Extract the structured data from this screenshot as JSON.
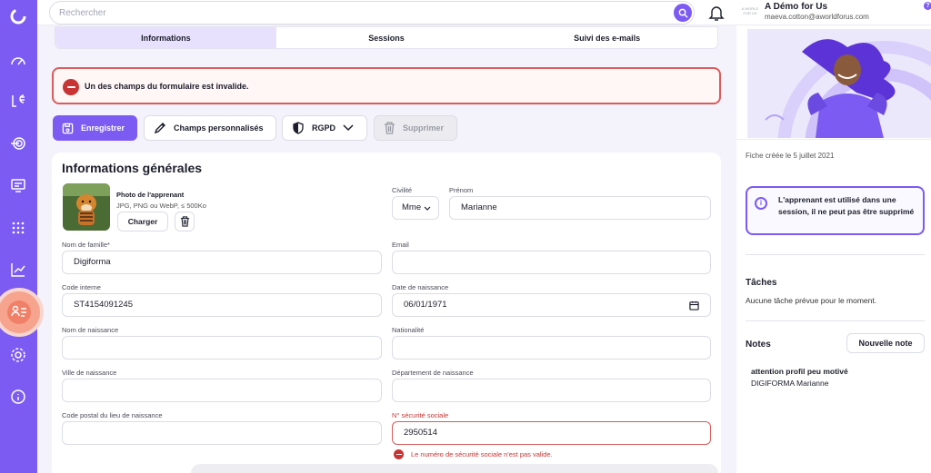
{
  "topbar": {
    "search_placeholder": "Rechercher",
    "brand_name": "A Démo for Us",
    "brand_email": "maeva.cotton@aworldforus.com",
    "brand_logo_text": "A WORLD FOR US",
    "help_label": "?"
  },
  "tabs": [
    {
      "label": "Informations",
      "active": true
    },
    {
      "label": "Sessions",
      "active": false
    },
    {
      "label": "Suivi des e-mails",
      "active": false
    }
  ],
  "error_banner": {
    "text": "Un des champs du formulaire est invalide."
  },
  "actions": {
    "save": "Enregistrer",
    "custom_fields": "Champs personnalisés",
    "rgpd": "RGPD",
    "delete": "Supprimer"
  },
  "form": {
    "title": "Informations générales",
    "photo": {
      "title": "Photo de l'apprenant",
      "hint": "JPG, PNG ou WebP, ≤ 500Ko",
      "load_label": "Charger"
    },
    "civilite": {
      "label": "Civilité",
      "value": "Mme"
    },
    "prenom": {
      "label": "Prénom",
      "value": "Marianne"
    },
    "nom": {
      "label": "Nom de famille*",
      "value": "Digiforma"
    },
    "email": {
      "label": "Email",
      "value": ""
    },
    "code_interne": {
      "label": "Code interne",
      "value": "ST4154091245"
    },
    "date_naissance": {
      "label": "Date de naissance",
      "value": "06/01/1971"
    },
    "nom_naissance": {
      "label": "Nom de naissance",
      "value": ""
    },
    "nationalite": {
      "label": "Nationalité",
      "value": ""
    },
    "ville_naissance": {
      "label": "Ville de naissance",
      "value": ""
    },
    "departement": {
      "label": "Département de naissance",
      "value": ""
    },
    "code_postal": {
      "label": "Code postal du lieu de naissance",
      "value": ""
    },
    "secu": {
      "label": "N° sécurité sociale",
      "value": "2950514",
      "error": "Le numéro de sécurité sociale n'est pas valide."
    }
  },
  "right_panel": {
    "created": "Fiche créée le 5 juillet 2021",
    "info": "L'apprenant est utilisé dans une session, il ne peut pas être supprimé",
    "tasks_title": "Tâches",
    "tasks_empty": "Aucune tâche prévue pour le moment.",
    "notes_title": "Notes",
    "new_note": "Nouvelle note",
    "note": {
      "title": "attention profil peu motivé",
      "author": "DIGIFORMA Marianne"
    }
  },
  "colors": {
    "accent": "#7b5bf2",
    "error": "#c83434",
    "active_nav": "#f08068"
  }
}
